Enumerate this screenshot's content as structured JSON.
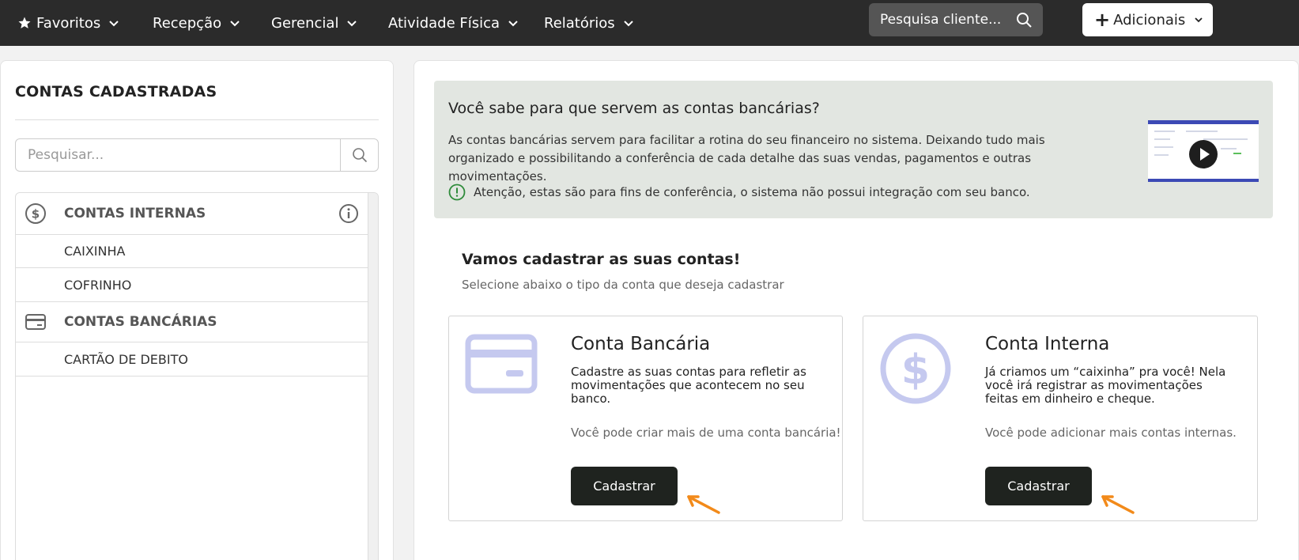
{
  "nav": {
    "items": [
      {
        "label": "Favoritos",
        "icon": "star-icon"
      },
      {
        "label": "Recepção"
      },
      {
        "label": "Gerencial"
      },
      {
        "label": "Atividade Física"
      },
      {
        "label": "Relatórios"
      }
    ],
    "search_placeholder": "Pesquisa cliente...",
    "add_label": "Adicionais"
  },
  "left": {
    "title": "CONTAS CADASTRADAS",
    "search_placeholder": "Pesquisar...",
    "groups": [
      {
        "label": "CONTAS INTERNAS",
        "icon": "dollar-circle-icon",
        "items": [
          "CAIXINHA",
          "COFRINHO"
        ]
      },
      {
        "label": "CONTAS BANCÁRIAS",
        "icon": "credit-card-icon",
        "items": [
          "CARTÃO DE DEBITO"
        ]
      }
    ]
  },
  "info": {
    "title": "Você sabe para que servem as contas bancárias?",
    "description": "As contas bancárias servem para facilitar a rotina do seu financeiro no sistema. Deixando tudo mais organizado e possibilitando a conferência de cada detalhe das suas vendas, pagamentos e outras movimentações.",
    "warning": "Atenção, estas são para fins de conferência, o sistema não possui integração com seu banco."
  },
  "register": {
    "title": "Vamos cadastrar as suas contas!",
    "subtitle": "Selecione abaixo o tipo da conta que deseja cadastrar",
    "cards": [
      {
        "title": "Conta Bancária",
        "description": "Cadastre as suas contas para refletir as movimentações que acontecem no seu banco.",
        "note": "Você pode criar mais de uma conta bancária!",
        "button": "Cadastrar"
      },
      {
        "title": "Conta Interna",
        "description": "Já criamos um “caixinha” pra você! Nela você irá registrar as movimentações feitas em dinheiro e cheque.",
        "note": "Você pode adicionar mais contas internas.",
        "button": "Cadastrar"
      }
    ]
  },
  "colors": {
    "topbar": "#2b2b2b",
    "accent_icon": "#c5c9ef",
    "button": "#1f231f",
    "arrow": "#f28a1a",
    "info_bg": "#e2e6e1",
    "warn_green": "#2e8b3a"
  }
}
